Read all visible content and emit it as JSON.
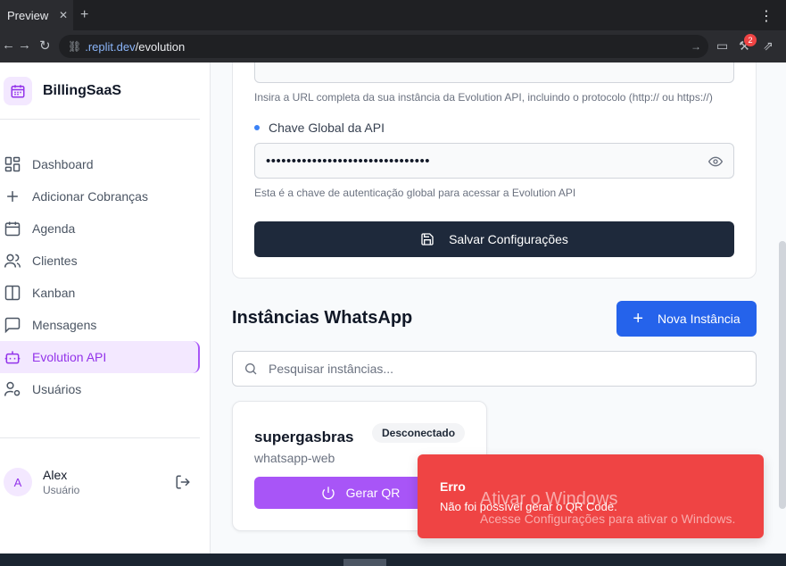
{
  "browser": {
    "tab_title": "Preview",
    "tab_close": "✕",
    "new_tab": "+",
    "menu": "⋮",
    "url_domain": ".replit.dev",
    "url_path": "/evolution",
    "notification_count": "2"
  },
  "sidebar": {
    "brand": "BillingSaaS",
    "items": [
      {
        "label": "Dashboard",
        "icon": "dashboard-icon"
      },
      {
        "label": "Adicionar Cobranças",
        "icon": "plus-icon"
      },
      {
        "label": "Agenda",
        "icon": "calendar-icon"
      },
      {
        "label": "Clientes",
        "icon": "users-icon"
      },
      {
        "label": "Kanban",
        "icon": "kanban-icon"
      },
      {
        "label": "Mensagens",
        "icon": "message-icon"
      },
      {
        "label": "Evolution API",
        "icon": "bot-icon",
        "active": true
      },
      {
        "label": "Usuários",
        "icon": "user-cog-icon"
      }
    ],
    "user": {
      "initial": "A",
      "name": "Alex",
      "role": "Usuário"
    }
  },
  "config": {
    "url_help": "Insira a URL completa da sua instância da Evolution API, incluindo o protocolo (http:// ou https://)",
    "key_label": "Chave Global da API",
    "key_value": "••••••••••••••••••••••••••••••••",
    "key_help": "Esta é a chave de autenticação global para acessar a Evolution API",
    "save_label": "Salvar Configurações"
  },
  "instances": {
    "title": "Instâncias WhatsApp",
    "new_label": "Nova Instância",
    "search_placeholder": "Pesquisar instâncias...",
    "items": [
      {
        "name": "supergasbras",
        "type": "whatsapp-web",
        "status": "Desconectado",
        "qr_label": "Gerar QR"
      }
    ]
  },
  "toast": {
    "title": "Erro",
    "message": "Não foi possível gerar o QR Code."
  },
  "watermark": {
    "title": "Ativar o Windows",
    "subtitle": "Acesse Configurações para ativar o Windows."
  },
  "colors": {
    "accent": "#a855f7",
    "primary": "#2563eb",
    "dark": "#1e293b",
    "error": "#ef4444"
  }
}
